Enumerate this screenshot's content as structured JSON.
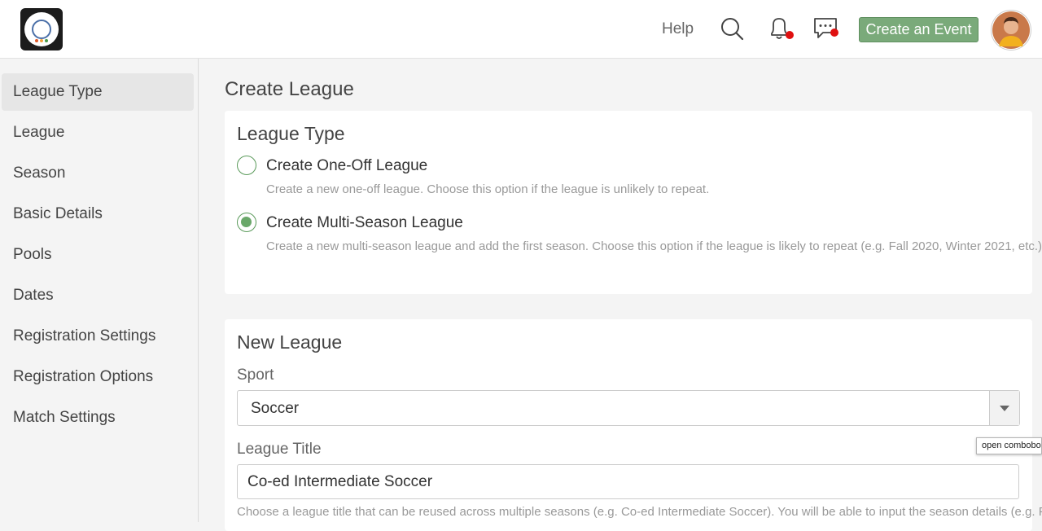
{
  "header": {
    "help_label": "Help",
    "create_event_label": "Create an Event",
    "icons": [
      "search-icon",
      "bell-icon",
      "chat-icon"
    ],
    "accent_color": "#7aaa7a",
    "notification_color": "#e01010"
  },
  "sidebar": {
    "items": [
      {
        "label": "League Type",
        "active": true
      },
      {
        "label": "League"
      },
      {
        "label": "Season"
      },
      {
        "label": "Basic Details"
      },
      {
        "label": "Pools"
      },
      {
        "label": "Dates"
      },
      {
        "label": "Registration Settings"
      },
      {
        "label": "Registration Options"
      },
      {
        "label": "Match Settings"
      }
    ]
  },
  "main": {
    "page_title": "Create League",
    "league_type_card": {
      "title": "League Type",
      "options": [
        {
          "label": "Create One-Off League",
          "description": "Create a new one-off league. Choose this option if the league is unlikely to repeat.",
          "selected": false
        },
        {
          "label": "Create Multi-Season League",
          "description": "Create a new multi-season league and add the first season. Choose this option if the league is likely to repeat (e.g. Fall 2020, Winter 2021, etc.)",
          "selected": true
        }
      ]
    },
    "new_league_card": {
      "title": "New League",
      "sport_label": "Sport",
      "sport_value": "Soccer",
      "title_label": "League Title",
      "title_value": "Co-ed Intermediate Soccer",
      "title_help": "Choose a league title that can be reused across multiple seasons (e.g. Co-ed Intermediate Soccer). You will be able to input the season details (e.g. Fall"
    }
  },
  "tooltip": "open combobox"
}
